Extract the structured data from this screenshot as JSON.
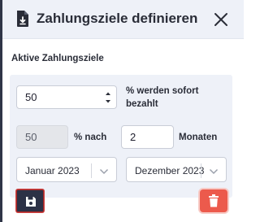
{
  "dialog": {
    "title": "Zahlungsziele definieren",
    "icons": {
      "header": "document-download-icon",
      "close": "close-icon"
    }
  },
  "section": {
    "label": "Aktive Zahlungsziele"
  },
  "row1": {
    "percent_value": "50",
    "percent_label": "% werden sofort bezahlt"
  },
  "row2": {
    "percent_value": "50",
    "percent_after_label": "% nach",
    "months_value": "2",
    "months_label": "Monaten"
  },
  "row3": {
    "start_month": "Januar 2023",
    "end_month": "Dezember 2023"
  },
  "actions": {
    "save_icon": "save-icon",
    "delete_icon": "trash-icon"
  },
  "colors": {
    "accent": "#2c3146",
    "danger": "#ec5a4c",
    "panel": "#eef1f8"
  }
}
